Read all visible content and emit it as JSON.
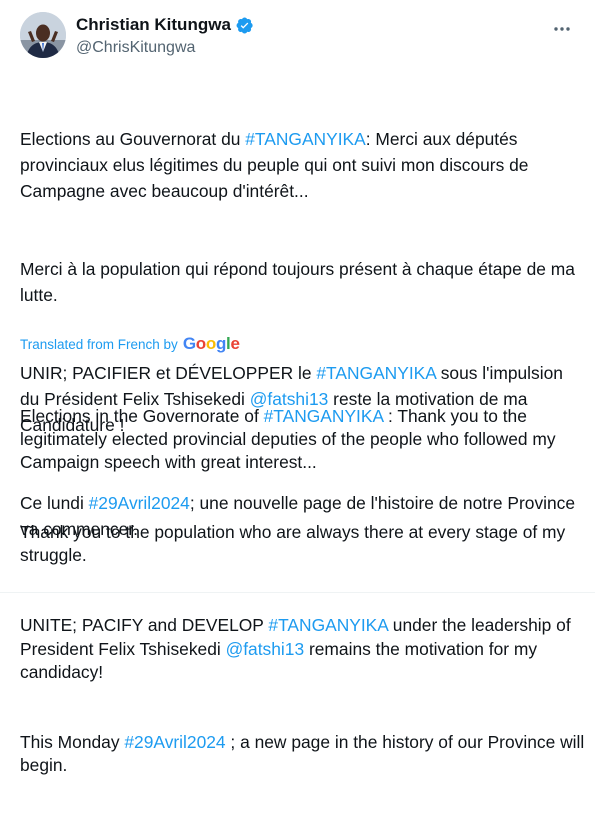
{
  "author": {
    "display_name": "Christian Kitungwa",
    "handle": "@ChrisKitungwa",
    "verified": true,
    "verified_badge_color": "#1d9bf0"
  },
  "menu_icon": "more-horizontal-icon",
  "original": {
    "p1": [
      "Elections au Gouvernorat du ",
      "#TANGANYIKA",
      ": Merci aux députés provinciaux elus légitimes du peuple qui ont suivi mon discours de Campagne avec beaucoup d'intérêt..."
    ],
    "p2": "Merci à la population qui répond toujours présent à chaque étape de ma lutte.",
    "p3": [
      "UNIR; PACIFIER et DÉVELOPPER le ",
      "#TANGANYIKA",
      " sous l'impulsion du Président Felix Tshisekedi ",
      "@fatshi13",
      " reste la motivation de ma Candidature !"
    ],
    "p4": [
      "Ce lundi ",
      "#29Avril2024",
      "; une nouvelle page de l'histoire de notre Province va commencer."
    ]
  },
  "translation_label": {
    "text": "Translated from French by",
    "brand": [
      "G",
      "o",
      "o",
      "g",
      "l",
      "e"
    ]
  },
  "translated": {
    "p1": [
      "Elections in the Governorate of ",
      "#TANGANYIKA",
      " : Thank you to the legitimately elected provincial deputies of the people who followed my Campaign speech with great interest..."
    ],
    "p2": "Thank you to the population who are always there at every stage of my struggle.",
    "p3": [
      "UNITE; PACIFY and DEVELOP ",
      "#TANGANYIKA",
      " under the leadership of President Felix Tshisekedi ",
      "@fatshi13",
      " remains the motivation for my candidacy!"
    ],
    "p4": [
      "This Monday ",
      "#29Avril2024",
      " ; a new page in the history of our Province will begin."
    ]
  },
  "colors": {
    "link": "#1d9bf0",
    "text": "#0f1419",
    "secondary": "#536471"
  }
}
